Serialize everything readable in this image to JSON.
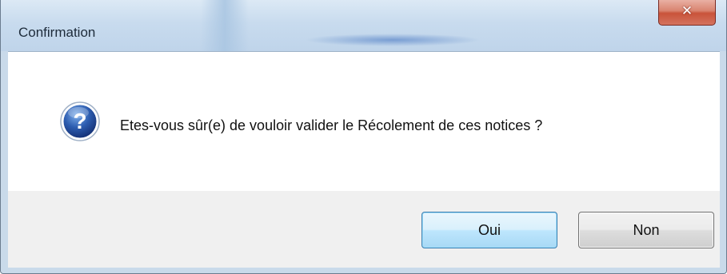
{
  "window": {
    "title": "Confirmation",
    "close_icon": "close-icon"
  },
  "message": {
    "icon": "question-icon",
    "text": "Etes-vous sûr(e) de vouloir valider le Récolement de ces notices ?"
  },
  "buttons": {
    "yes_label": "Oui",
    "no_label": "Non"
  },
  "colors": {
    "close_button": "#c9533a",
    "question_icon": "#2d5db0",
    "default_button_border": "#3c7fb1"
  }
}
